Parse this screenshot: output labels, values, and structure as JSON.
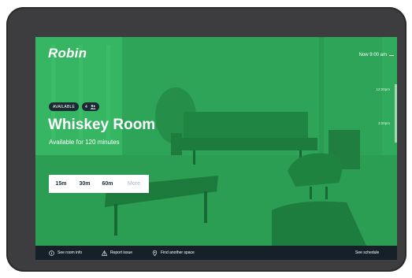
{
  "header": {
    "logo": "Robin",
    "now_label": "Now 9:00 am"
  },
  "timeline": {
    "times": [
      "12:00pm",
      "3:00pm"
    ]
  },
  "room": {
    "status_badge": "AVAILABLE",
    "capacity": "4",
    "name": "Whiskey Room",
    "availability": "Available for 120 minutes"
  },
  "durations": [
    "15m",
    "30m",
    "60m",
    "More"
  ],
  "footer": {
    "room_info": "See room info",
    "report_issue": "Report issue",
    "find_space": "Find another space",
    "see_schedule": "See schedule"
  },
  "colors": {
    "accent": "#2faa5a",
    "footer_bg": "#162029",
    "bezel": "#3d3d3f"
  },
  "icons": [
    "people-icon",
    "info-icon",
    "warning-icon",
    "location-pin-icon"
  ]
}
